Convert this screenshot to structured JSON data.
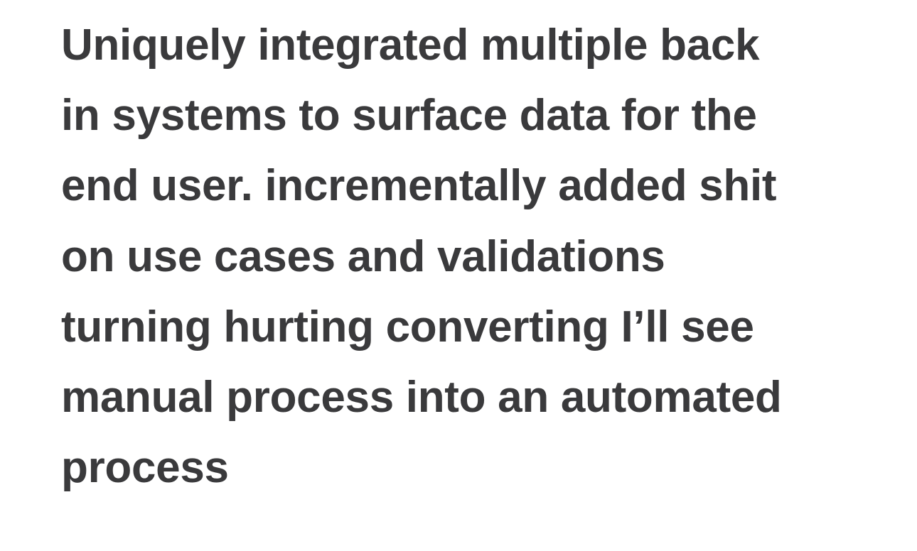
{
  "note": {
    "lines": [
      "Uniquely integrated multiple back",
      "in systems to surface data for the",
      "end user.  incrementally added shit",
      "on use cases and validations",
      "turning hurting converting I’ll see",
      "manual process into an automated",
      "process"
    ]
  }
}
